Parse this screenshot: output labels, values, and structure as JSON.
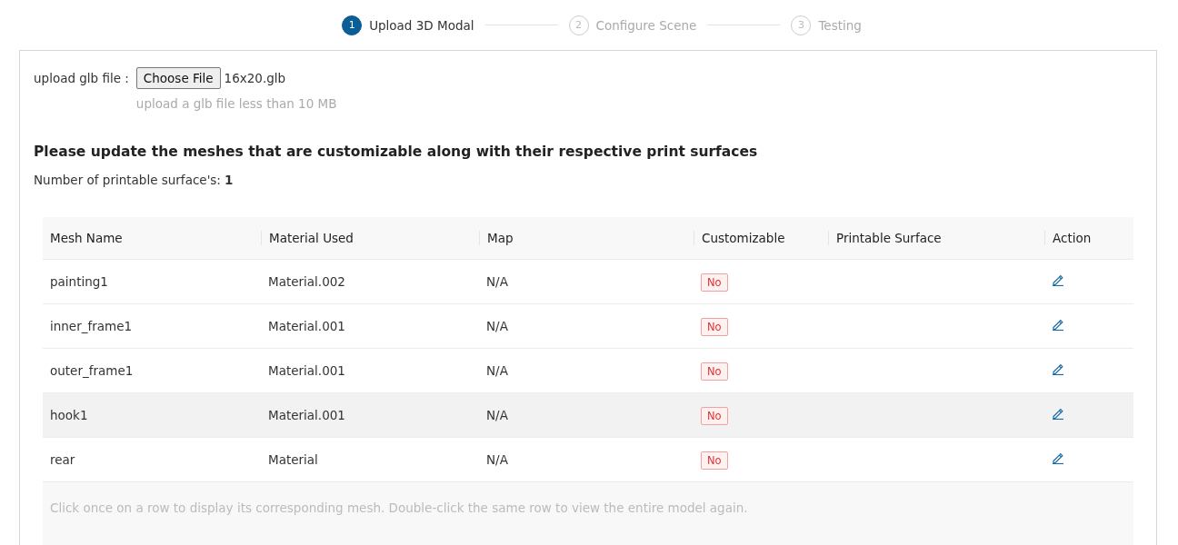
{
  "steps": [
    {
      "number": "1",
      "label": "Upload 3D Modal",
      "selected": true
    },
    {
      "number": "2",
      "label": "Configure Scene",
      "selected": false
    },
    {
      "number": "3",
      "label": "Testing",
      "selected": false
    }
  ],
  "upload": {
    "label": "upload glb file :",
    "button": "Choose File",
    "file_name": "16x20.glb",
    "hint": "upload a glb file less than 10 MB"
  },
  "heading": "Please update the meshes that are customizable along with their respective print surfaces",
  "count": {
    "label": "Number of printable surface's:",
    "value": "1"
  },
  "table": {
    "columns": [
      "Mesh Name",
      "Material Used",
      "Map",
      "Customizable",
      "Printable Surface",
      "Action"
    ],
    "rows": [
      {
        "mesh": "painting1",
        "material": "Material.002",
        "map": "N/A",
        "customizable": "No",
        "selected": false
      },
      {
        "mesh": "inner_frame1",
        "material": "Material.001",
        "map": "N/A",
        "customizable": "No",
        "selected": false
      },
      {
        "mesh": "outer_frame1",
        "material": "Material.001",
        "map": "N/A",
        "customizable": "No",
        "selected": false
      },
      {
        "mesh": "hook1",
        "material": "Material.001",
        "map": "N/A",
        "customizable": "No",
        "selected": true
      },
      {
        "mesh": "rear",
        "material": "Material",
        "map": "N/A",
        "customizable": "No",
        "selected": false
      }
    ],
    "footer": "Click once on a row to display its corresponding mesh. Double-click the same row to view the entire model again."
  }
}
